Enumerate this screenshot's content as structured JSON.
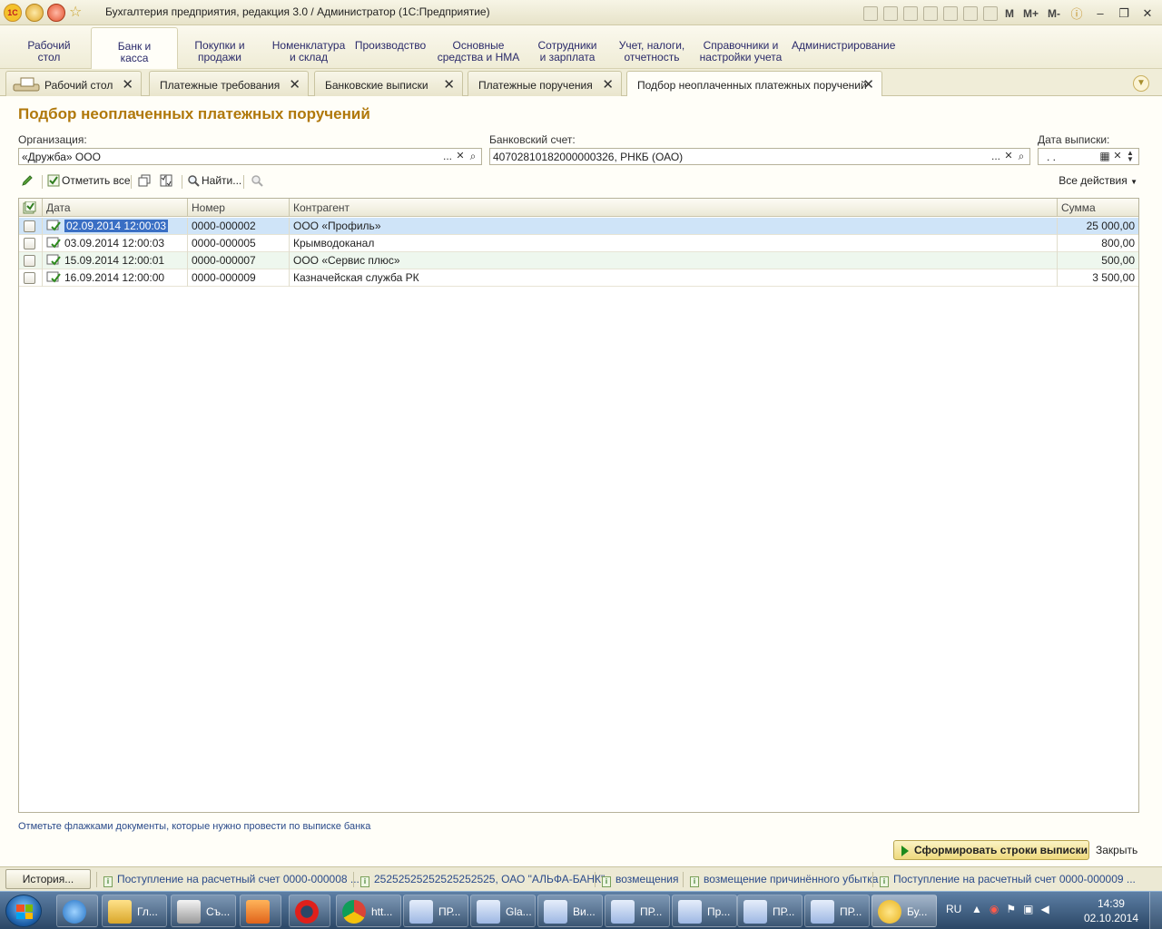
{
  "window": {
    "title": "Бухгалтерия предприятия, редакция 3.0 / Администратор  (1С:Предприятие)",
    "m_buttons": [
      "M",
      "M+",
      "M-"
    ]
  },
  "sections": [
    {
      "label": "Рабочий\nстол"
    },
    {
      "label": "Банк и\nкасса"
    },
    {
      "label": "Покупки и\nпродажи"
    },
    {
      "label": "Номенклатура\nи склад"
    },
    {
      "label": "Производство"
    },
    {
      "label": "Основные\nсредства и НМА"
    },
    {
      "label": "Сотрудники\nи зарплата"
    },
    {
      "label": "Учет, налоги,\nотчетность"
    },
    {
      "label": "Справочники и\nнастройки учета"
    },
    {
      "label": "Администрирование"
    }
  ],
  "tabs": [
    {
      "label": "Рабочий стол"
    },
    {
      "label": "Платежные требования"
    },
    {
      "label": "Банковские выписки"
    },
    {
      "label": "Платежные поручения"
    },
    {
      "label": "Подбор неоплаченных платежных поручений"
    }
  ],
  "form": {
    "title": "Подбор неоплаченных платежных поручений",
    "organization_label": "Организация:",
    "organization_value": "«Дружба» ООО",
    "bank_account_label": "Банковский счет:",
    "bank_account_value": "40702810182000000326, РНКБ (ОАО)",
    "statement_date_label": "Дата выписки:",
    "statement_date_value": ". .",
    "ellipsis": "...",
    "clear": "✕"
  },
  "toolbar": {
    "mark_all": "Отметить все",
    "find": "Найти...",
    "all_actions": "Все действия"
  },
  "table": {
    "columns": [
      "Дата",
      "Номер",
      "Контрагент",
      "Сумма"
    ],
    "rows": [
      {
        "date": "02.09.2014 12:00:03",
        "number": "0000-000002",
        "counterparty": "ООО «Профиль»",
        "amount": "25 000,00"
      },
      {
        "date": "03.09.2014 12:00:03",
        "number": "0000-000005",
        "counterparty": "Крымводоканал",
        "amount": "800,00"
      },
      {
        "date": "15.09.2014 12:00:01",
        "number": "0000-000007",
        "counterparty": "ООО «Сервис плюс»",
        "amount": "500,00"
      },
      {
        "date": "16.09.2014 12:00:00",
        "number": "0000-000009",
        "counterparty": "Казначейская служба РК",
        "amount": "3 500,00"
      }
    ]
  },
  "footer": {
    "hint": "Отметьте флажками документы, которые нужно провести по выписке банка",
    "generate_button": "Сформировать строки выписки",
    "close_button": "Закрыть"
  },
  "history": {
    "button": "История...",
    "items": [
      "Поступление на расчетный счет 0000-000008 ...",
      "25252525252525252525, ОАО \"АЛЬФА-БАНК\"",
      "возмещения",
      "возмещение причинённого убытка",
      "Поступление на расчетный счет 0000-000009 ..."
    ]
  },
  "taskbar": {
    "items": [
      {
        "label": "",
        "icon": "ie-icon"
      },
      {
        "label": "Гл...",
        "icon": "folder-icon"
      },
      {
        "label": "Съ...",
        "icon": "scanner-icon"
      },
      {
        "label": "",
        "icon": "media-player-icon"
      },
      {
        "label": "",
        "icon": "opera-icon"
      },
      {
        "label": "htt...",
        "icon": "chrome-icon"
      },
      {
        "label": "ПР...",
        "icon": "word-icon"
      },
      {
        "label": "Gla...",
        "icon": "word-icon"
      },
      {
        "label": "Ви...",
        "icon": "word-icon"
      },
      {
        "label": "ПР...",
        "icon": "word-icon"
      },
      {
        "label": "Пр...",
        "icon": "word-icon"
      },
      {
        "label": "ПР...",
        "icon": "word-icon"
      },
      {
        "label": "ПР...",
        "icon": "word-icon"
      },
      {
        "label": "Бу...",
        "icon": "1c-icon"
      }
    ],
    "lang": "RU",
    "time": "14:39",
    "date": "02.10.2014"
  }
}
